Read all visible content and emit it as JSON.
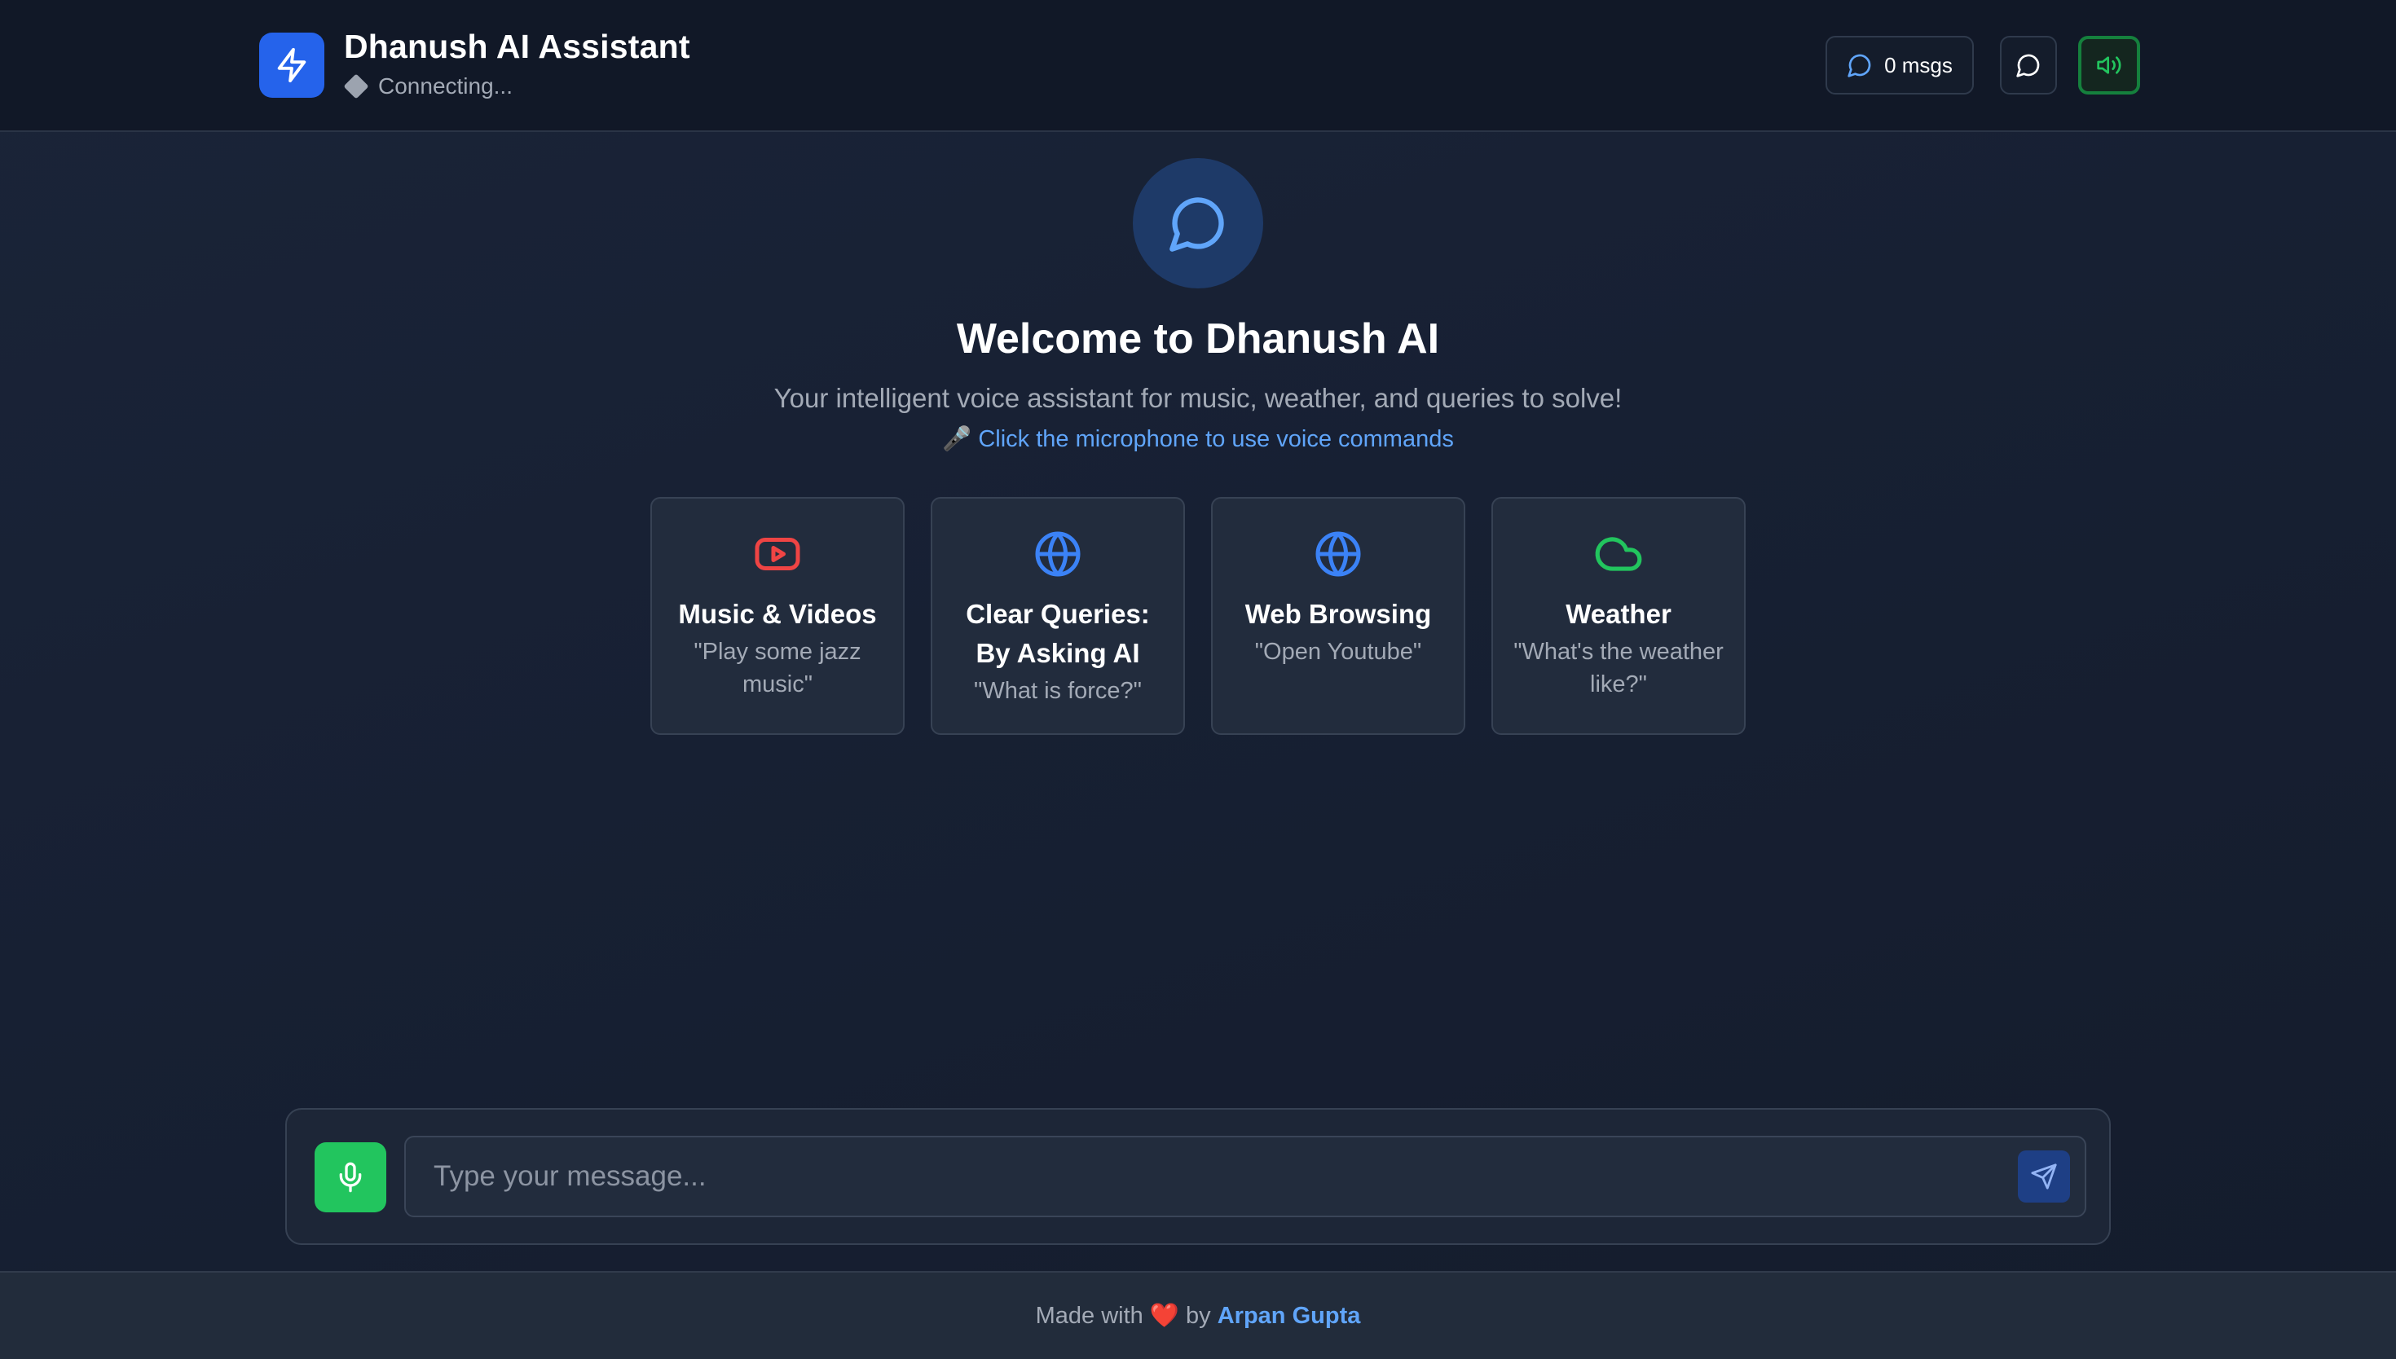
{
  "header": {
    "title": "Dhanush AI Assistant",
    "status": "Connecting...",
    "message_count_label": "0 msgs",
    "icons": {
      "logo": "lightning-bolt-icon",
      "messages": "chat-bubble-icon",
      "chat": "chat-bubble-icon",
      "speaker": "speaker-volume-icon"
    }
  },
  "hero": {
    "icon": "chat-bubble-icon",
    "title": "Welcome to Dhanush AI",
    "subtitle": "Your intelligent voice assistant for music, weather, and queries to solve!",
    "hint_emoji": "🎤",
    "hint": "Click the microphone to use voice commands"
  },
  "cards": [
    {
      "icon": "youtube-play-icon",
      "title": "Music & Videos",
      "example": "\"Play some jazz music\"",
      "color": "#ef4444"
    },
    {
      "icon": "globe-icon",
      "title": "Clear Queries: By Asking AI",
      "example": "\"What is force?\"",
      "color": "#3b82f6"
    },
    {
      "icon": "globe-icon",
      "title": "Web Browsing",
      "example": "\"Open Youtube\"",
      "color": "#3b82f6"
    },
    {
      "icon": "cloud-icon",
      "title": "Weather",
      "example": "\"What's the weather like?\"",
      "color": "#22c55e"
    }
  ],
  "composer": {
    "placeholder": "Type your message...",
    "mic_icon": "microphone-icon",
    "send_icon": "send-icon"
  },
  "footer": {
    "prefix": "Made with ",
    "heart": "❤️",
    "by": " by ",
    "author": "Arpan Gupta"
  },
  "colors": {
    "accent_blue": "#2563eb",
    "accent_green": "#22c55e",
    "link_blue": "#60a5fa",
    "background": "#172033"
  }
}
